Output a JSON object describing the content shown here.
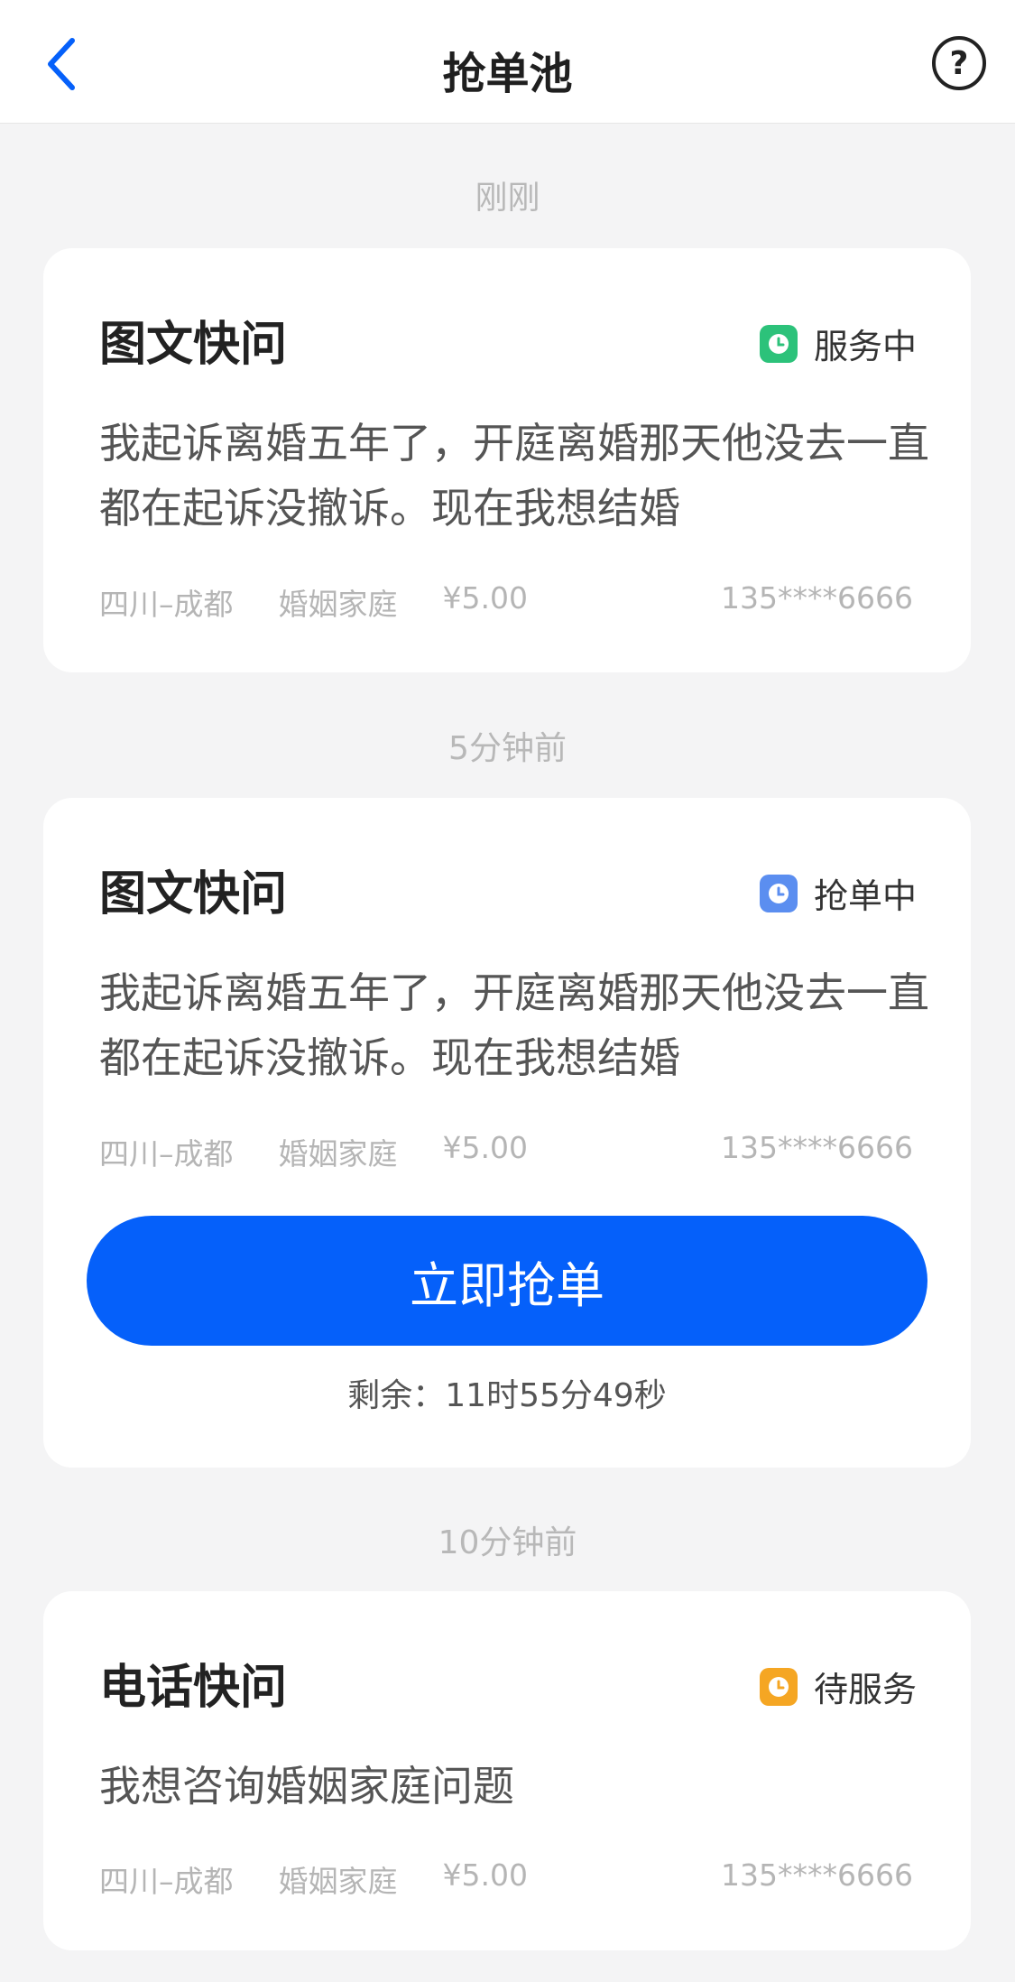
{
  "header": {
    "title": "抢单池",
    "back_icon": "chevron-left-icon",
    "help_icon": "question-circle-icon",
    "help_symbol": "?"
  },
  "colors": {
    "primary": "#0560fa",
    "status_serving": "#2cc27a",
    "status_grabbing": "#5b8ef0",
    "status_pending": "#f5a623"
  },
  "groups": [
    {
      "time": "刚刚",
      "card": {
        "title": "图文快问",
        "status": "服务中",
        "status_icon": "clock-icon",
        "description": "我起诉离婚五年了，开庭离婚那天他没去一直都在起诉没撤诉。现在我想结婚",
        "location": "四川–成都",
        "category": "婚姻家庭",
        "price": "¥5.00",
        "phone": "135****6666"
      }
    },
    {
      "time": "5分钟前",
      "card": {
        "title": "图文快问",
        "status": "抢单中",
        "status_icon": "clock-icon",
        "description": "我起诉离婚五年了，开庭离婚那天他没去一直都在起诉没撤诉。现在我想结婚",
        "location": "四川–成都",
        "category": "婚姻家庭",
        "price": "¥5.00",
        "phone": "135****6666",
        "button_label": "立即抢单",
        "remaining": "剩余：11时55分49秒"
      }
    },
    {
      "time": "10分钟前",
      "card": {
        "title": "电话快问",
        "status": "待服务",
        "status_icon": "clock-icon",
        "description": "我想咨询婚姻家庭问题",
        "location": "四川–成都",
        "category": "婚姻家庭",
        "price": "¥5.00",
        "phone": "135****6666"
      }
    }
  ]
}
